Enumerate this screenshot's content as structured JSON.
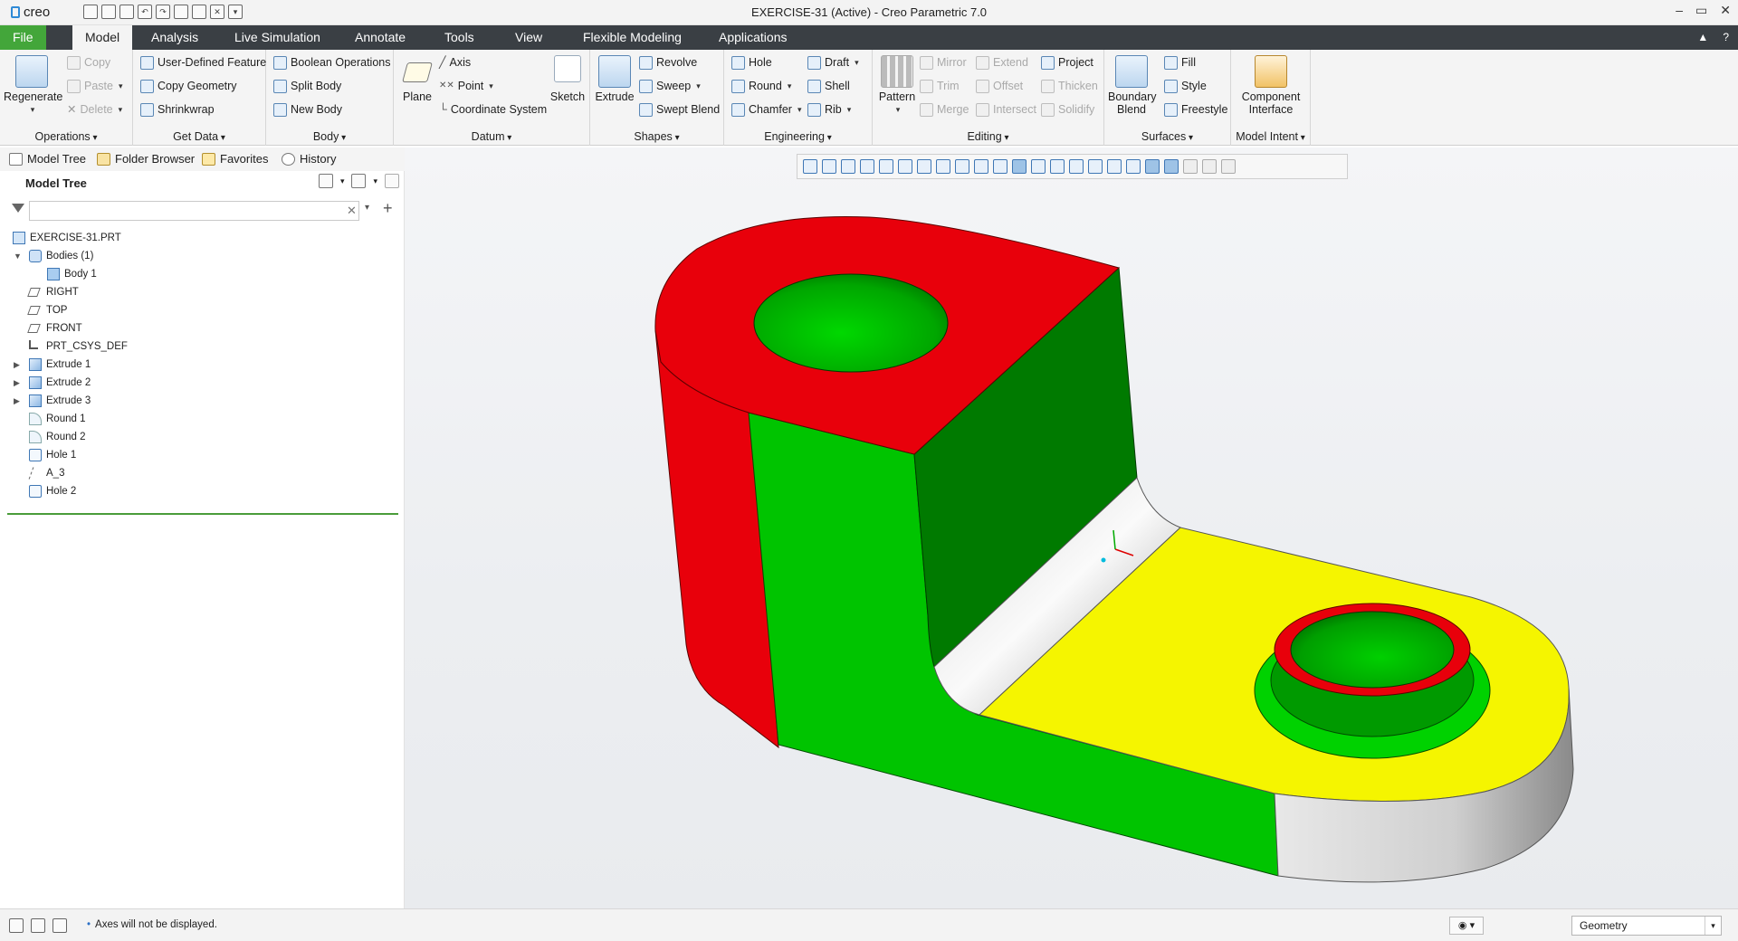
{
  "app": {
    "logo": "creo",
    "window_title": "EXERCISE-31 (Active) - Creo Parametric 7.0",
    "window_controls": [
      "–",
      "▭",
      "✕"
    ]
  },
  "menu": {
    "tabs": [
      "File",
      "Model",
      "Analysis",
      "Live Simulation",
      "Annotate",
      "Tools",
      "View",
      "Flexible Modeling",
      "Applications"
    ],
    "active": "Model"
  },
  "ribbon": {
    "operations": {
      "title": "Operations",
      "regenerate": "Regenerate",
      "copy": "Copy",
      "paste": "Paste",
      "delete": "Delete"
    },
    "get_data": {
      "title": "Get Data",
      "udf": "User-Defined Feature",
      "copy_geometry": "Copy Geometry",
      "shrinkwrap": "Shrinkwrap"
    },
    "body": {
      "title": "Body",
      "boolean": "Boolean Operations",
      "split": "Split Body",
      "new": "New Body"
    },
    "datum": {
      "title": "Datum",
      "plane": "Plane",
      "axis": "Axis",
      "point": "Point",
      "csys": "Coordinate System",
      "sketch": "Sketch"
    },
    "shapes": {
      "title": "Shapes",
      "extrude": "Extrude",
      "revolve": "Revolve",
      "sweep": "Sweep",
      "swept_blend": "Swept Blend"
    },
    "engineering": {
      "title": "Engineering",
      "hole": "Hole",
      "round": "Round",
      "chamfer": "Chamfer",
      "draft": "Draft",
      "shell": "Shell",
      "rib": "Rib"
    },
    "editing": {
      "title": "Editing",
      "pattern": "Pattern",
      "mirror": "Mirror",
      "trim": "Trim",
      "merge": "Merge",
      "extend": "Extend",
      "offset": "Offset",
      "intersect": "Intersect",
      "project": "Project",
      "thicken": "Thicken",
      "solidify": "Solidify"
    },
    "surfaces": {
      "title": "Surfaces",
      "boundary_blend_1": "Boundary",
      "boundary_blend_2": "Blend",
      "fill": "Fill",
      "style": "Style",
      "freestyle": "Freestyle"
    },
    "model_intent": {
      "title": "Model Intent",
      "component_interface_1": "Component",
      "component_interface_2": "Interface"
    }
  },
  "navigator": {
    "tabs": [
      "Model Tree",
      "Folder Browser",
      "Favorites",
      "History"
    ],
    "header": "Model Tree",
    "filter_placeholder": "",
    "items": [
      {
        "label": "EXERCISE-31.PRT",
        "icon": "part-icon",
        "level": 0,
        "expander": ""
      },
      {
        "label": "Bodies (1)",
        "icon": "bodies-icon",
        "level": 1,
        "expander": "▼"
      },
      {
        "label": "Body 1",
        "icon": "body-icon",
        "level": 2,
        "expander": ""
      },
      {
        "label": "RIGHT",
        "icon": "datum-plane-icon",
        "level": 1,
        "expander": ""
      },
      {
        "label": "TOP",
        "icon": "datum-plane-icon",
        "level": 1,
        "expander": ""
      },
      {
        "label": "FRONT",
        "icon": "datum-plane-icon",
        "level": 1,
        "expander": ""
      },
      {
        "label": "PRT_CSYS_DEF",
        "icon": "csys-icon",
        "level": 1,
        "expander": ""
      },
      {
        "label": "Extrude 1",
        "icon": "extrude-icon",
        "level": 1,
        "expander": "▶"
      },
      {
        "label": "Extrude 2",
        "icon": "extrude-icon",
        "level": 1,
        "expander": "▶"
      },
      {
        "label": "Extrude 3",
        "icon": "extrude-icon",
        "level": 1,
        "expander": "▶"
      },
      {
        "label": "Round 1",
        "icon": "round-icon",
        "level": 1,
        "expander": ""
      },
      {
        "label": "Round 2",
        "icon": "round-icon",
        "level": 1,
        "expander": ""
      },
      {
        "label": "Hole 1",
        "icon": "hole-icon",
        "level": 1,
        "expander": ""
      },
      {
        "label": "A_3",
        "icon": "axis-icon",
        "level": 1,
        "expander": ""
      },
      {
        "label": "Hole 2",
        "icon": "hole-icon",
        "level": 1,
        "expander": ""
      }
    ]
  },
  "status": {
    "message": "Axes will not be displayed.",
    "selection_filter": "Geometry"
  },
  "colors": {
    "file_tab": "#43a63a",
    "menubar": "#3a3f44",
    "red_face": "#e8000b",
    "green_face": "#00c400",
    "yellow_face": "#f5f500",
    "dark_green_face": "#007a00"
  }
}
